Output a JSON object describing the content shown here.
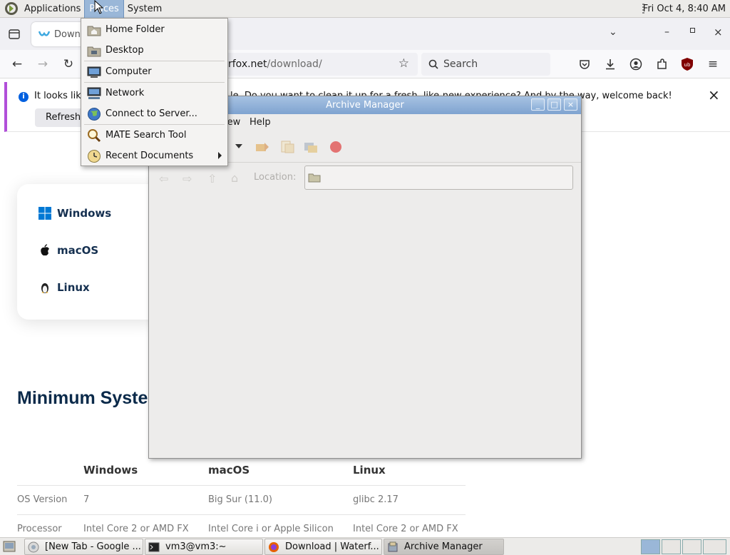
{
  "top_panel": {
    "menus": [
      "Applications",
      "Places",
      "System"
    ],
    "clock": "Fri Oct  4,  8:40 AM"
  },
  "firefox": {
    "tab_title": "Downl",
    "url_host_tail": "rfox.net",
    "url_path": "/download/",
    "search_placeholder": "Search",
    "notification_text": "It looks like",
    "notification_text_right": "le. Do you want to clean it up for a fresh, like-new experience? And by the way, welcome back!",
    "refresh_label": "Refresh F",
    "os_items": [
      "Windows",
      "macOS",
      "Linux"
    ],
    "section_title": "Minimum Syste",
    "table": {
      "headers": [
        "Windows",
        "macOS",
        "Linux"
      ],
      "rows": [
        {
          "label": "OS Version",
          "cells": [
            "7",
            "Big Sur (11.0)",
            "glibc 2.17"
          ]
        },
        {
          "label": "Processor",
          "cells": [
            "Intel Core 2 or AMD FX",
            "Intel Core i or Apple Silicon",
            "Intel Core 2 or AMD FX"
          ]
        }
      ]
    }
  },
  "archive_manager": {
    "title": "Archive Manager",
    "menus": [
      "iew",
      "Help"
    ],
    "location_label": "Location:"
  },
  "places_menu": {
    "items": [
      {
        "label": "Home Folder",
        "icon": "home-folder-icon"
      },
      {
        "label": "Desktop",
        "icon": "desktop-folder-icon"
      },
      {
        "label": "Computer",
        "icon": "computer-icon"
      },
      {
        "label": "Network",
        "icon": "network-icon"
      },
      {
        "label": "Connect to Server...",
        "icon": "globe-icon"
      },
      {
        "label": "MATE Search Tool",
        "icon": "magnifier-icon"
      },
      {
        "label": "Recent Documents",
        "icon": "clock-icon"
      }
    ]
  },
  "taskbar": {
    "tasks": [
      "[New Tab - Google ...",
      "vm3@vm3:~",
      "Download | Waterf...",
      "Archive Manager"
    ]
  }
}
